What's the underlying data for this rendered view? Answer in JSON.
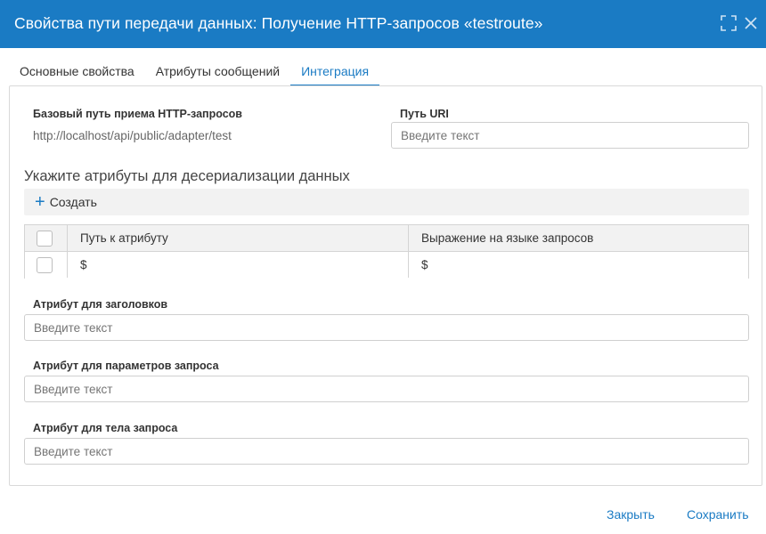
{
  "dialog": {
    "title": "Свойства пути передачи данных: Получение HTTP-запросов «testroute»",
    "maximize_icon": "maximize-icon",
    "close_icon": "close-icon"
  },
  "tabs": [
    {
      "label": "Основные свойства",
      "active": false
    },
    {
      "label": "Атрибуты сообщений",
      "active": false
    },
    {
      "label": "Интеграция",
      "active": true
    }
  ],
  "integration": {
    "base_path_label": "Базовый путь приема HTTP-запросов",
    "base_path_value": "http://localhost/api/public/adapter/test",
    "uri_label": "Путь URI",
    "uri_value": "",
    "uri_placeholder": "Введите текст",
    "deserialization_title": "Укажите атрибуты для десериализации данных",
    "create_label": "Создать",
    "grid": {
      "columns": [
        "Путь к атрибуту",
        "Выражение на языке запросов"
      ],
      "rows": [
        {
          "path": "$",
          "expression": "$"
        }
      ]
    },
    "headers_attr_label": "Атрибут для заголовков",
    "headers_attr_placeholder": "Введите текст",
    "params_attr_label": "Атрибут для параметров запроса",
    "params_attr_placeholder": "Введите текст",
    "body_attr_label": "Атрибут для тела запроса",
    "body_attr_placeholder": "Введите текст"
  },
  "footer": {
    "close_label": "Закрыть",
    "save_label": "Сохранить"
  },
  "colors": {
    "accent": "#1a7bc4",
    "titlebar": "#1a7bc4"
  }
}
